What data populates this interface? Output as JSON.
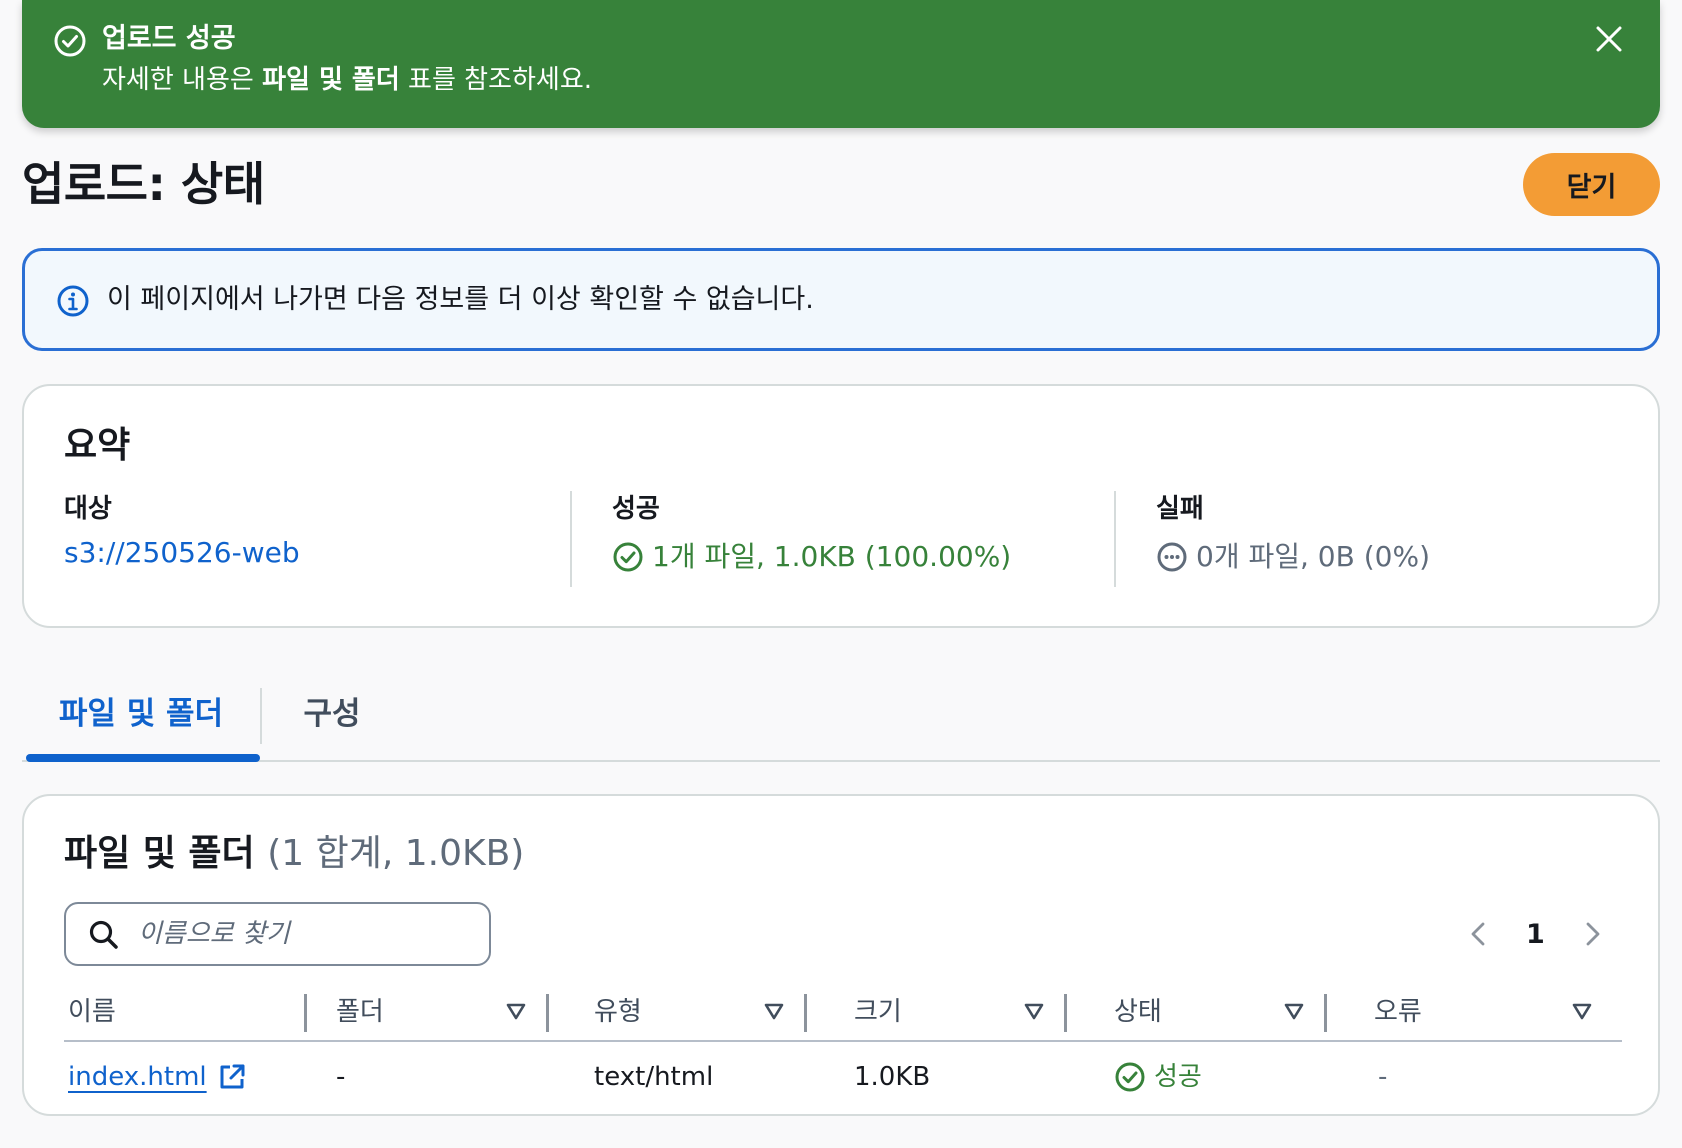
{
  "flash": {
    "title": "업로드 성공",
    "desc_prefix": "자세한 내용은 ",
    "desc_bold": "파일 및 폴더",
    "desc_suffix": " 표를 참조하세요.",
    "icon": "check-circle-icon",
    "close_icon": "close-icon",
    "color": "#37823a"
  },
  "header": {
    "title": "업로드: 상태",
    "close_label": "닫기",
    "close_color": "#f39c35"
  },
  "info": {
    "text": "이 페이지에서 나가면 다음 정보를 더 이상 확인할 수 없습니다.",
    "icon": "info-icon"
  },
  "summary": {
    "title": "요약",
    "target_label": "대상",
    "target_value": "s3://250526-web",
    "success_label": "성공",
    "success_value": "1개 파일, 1.0KB (100.00%)",
    "fail_label": "실패",
    "fail_value": "0개 파일, 0B (0%)"
  },
  "tabs": [
    {
      "label": "파일 및 폴더",
      "active": true
    },
    {
      "label": "구성",
      "active": false
    }
  ],
  "files": {
    "title": "파일 및 폴더",
    "count": "(1 합계, 1.0KB)",
    "search_placeholder": "이름으로 찾기",
    "page": "1",
    "columns": [
      "이름",
      "폴더",
      "유형",
      "크기",
      "상태",
      "오류"
    ],
    "rows": [
      {
        "name": "index.html",
        "folder": "-",
        "type": "text/html",
        "size": "1.0KB",
        "status": "성공",
        "error": "-"
      }
    ]
  }
}
